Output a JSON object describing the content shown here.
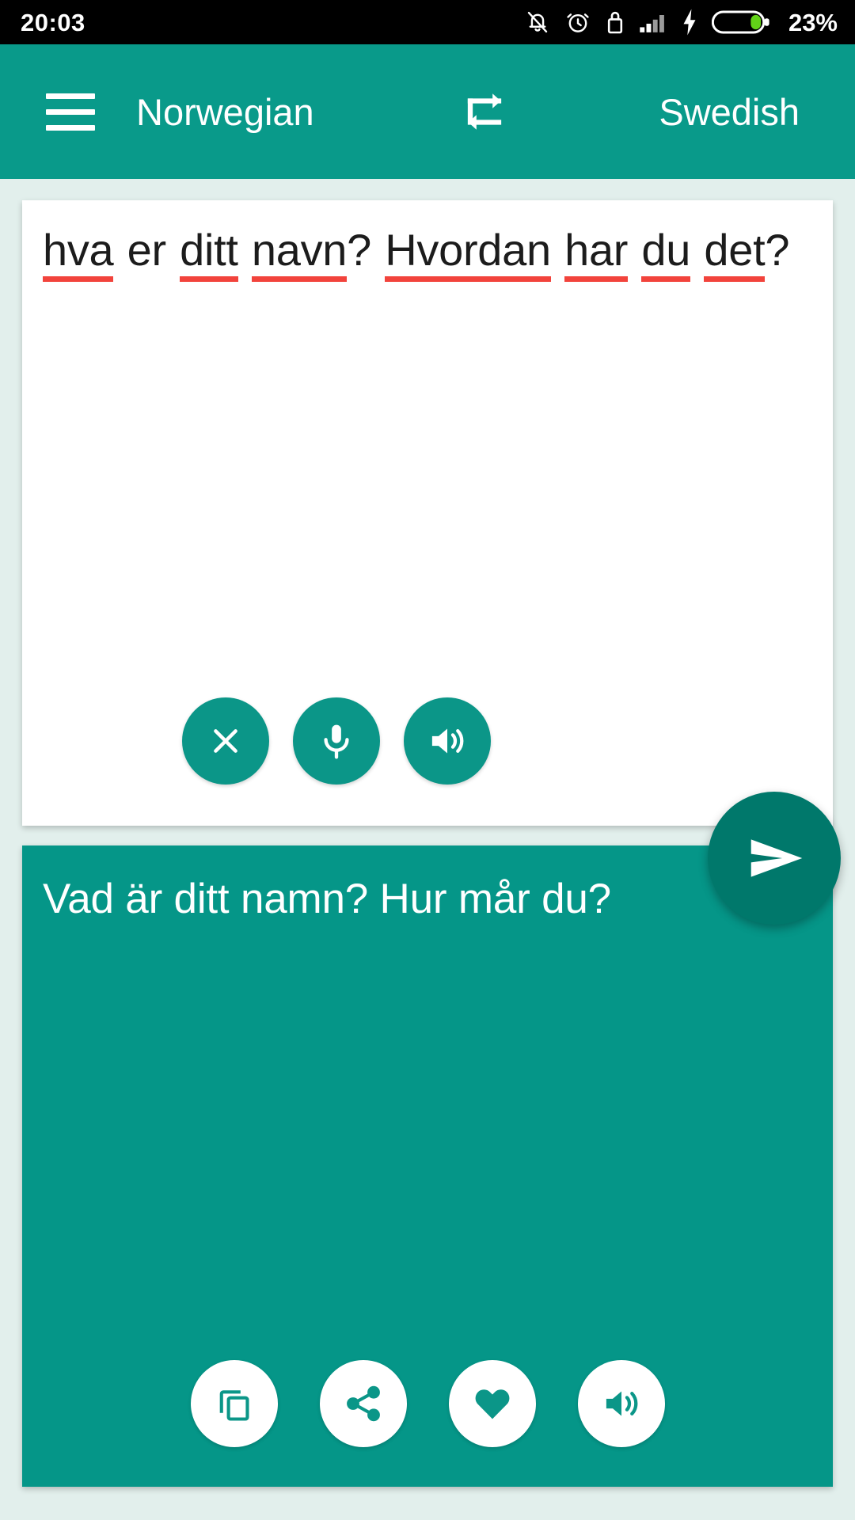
{
  "status_bar": {
    "time": "20:03",
    "battery_percent": "23%",
    "icons": [
      "bell-muted-icon",
      "alarm-clock-icon",
      "lock-icon",
      "signal-bars-icon",
      "charging-bolt-icon",
      "battery-icon"
    ]
  },
  "app_bar": {
    "menu_icon": "hamburger-menu-icon",
    "source_language": "Norwegian",
    "swap_icon": "swap-languages-icon",
    "target_language": "Swedish"
  },
  "input_card": {
    "text": "hva er ditt navn? Hvordan har du det?",
    "spellcheck_words": [
      "hva",
      "ditt",
      "navn",
      "Hvordan",
      "har",
      "du",
      "det"
    ],
    "tokens": [
      {
        "text": "hva",
        "misspelled": true
      },
      {
        "text": "er",
        "misspelled": false
      },
      {
        "text": "ditt",
        "misspelled": true
      },
      {
        "text": "navn",
        "misspelled": true
      },
      {
        "text": "?",
        "misspelled": false
      },
      {
        "text": "Hvordan",
        "misspelled": true
      },
      {
        "text": "har",
        "misspelled": true
      },
      {
        "text": "du",
        "misspelled": true
      },
      {
        "text": "det",
        "misspelled": true
      },
      {
        "text": "?",
        "misspelled": false
      }
    ],
    "actions": [
      {
        "name": "clear-button",
        "icon": "close-icon"
      },
      {
        "name": "microphone-button",
        "icon": "microphone-icon"
      },
      {
        "name": "speak-source-button",
        "icon": "speaker-icon"
      }
    ]
  },
  "send_button": {
    "icon": "send-icon",
    "label": "Send"
  },
  "output_card": {
    "text": "Vad är ditt namn? Hur mår du?",
    "actions": [
      {
        "name": "copy-button",
        "icon": "copy-icon"
      },
      {
        "name": "share-button",
        "icon": "share-icon"
      },
      {
        "name": "favorite-button",
        "icon": "heart-icon"
      },
      {
        "name": "speak-translation-button",
        "icon": "speaker-icon"
      }
    ]
  },
  "colors": {
    "primary_teal": "#099a8a",
    "card_teal": "#059688",
    "fab_teal": "#00786b",
    "page_background": "#e2efec",
    "spellcheck_red": "#f2433c",
    "status_bar": "#000000",
    "battery_green": "#62d318"
  }
}
